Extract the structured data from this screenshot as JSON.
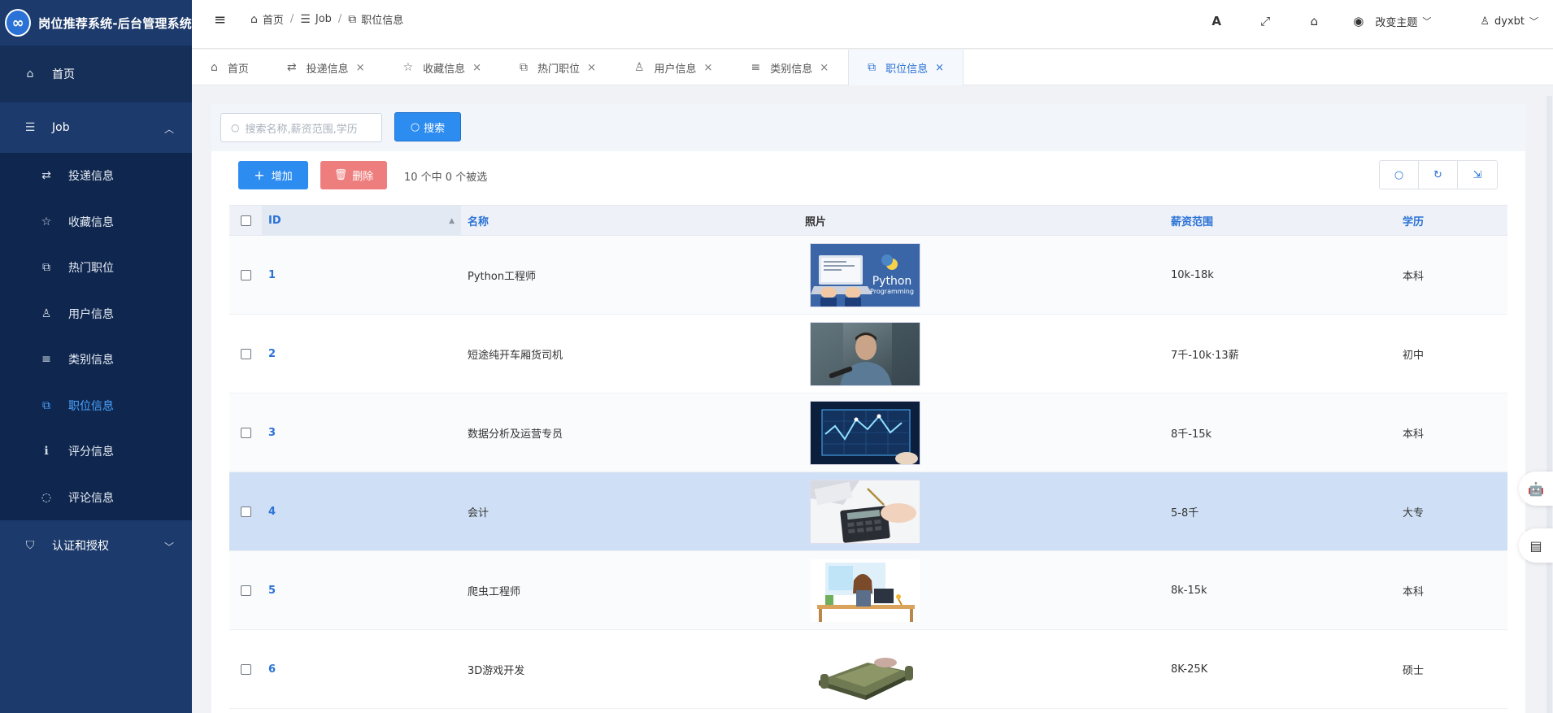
{
  "app_title": "岗位推荐系统-后台管理系统",
  "logo_glyph": "∞",
  "sidebar": {
    "home": "首页",
    "job_group": "Job",
    "items": [
      {
        "label": "投递信息",
        "icon": "⇄"
      },
      {
        "label": "收藏信息",
        "icon": "☆"
      },
      {
        "label": "热门职位",
        "icon": "⧉"
      },
      {
        "label": "用户信息",
        "icon": "♙"
      },
      {
        "label": "类别信息",
        "icon": "≡"
      },
      {
        "label": "职位信息",
        "icon": "⧉"
      },
      {
        "label": "评分信息",
        "icon": "ℹ"
      },
      {
        "label": "评论信息",
        "icon": "◌"
      }
    ],
    "auth_group": "认证和授权"
  },
  "header": {
    "breadcrumb": [
      "首页",
      "Job",
      "职位信息"
    ],
    "theme_label": "改变主题",
    "user_name": "dyxbt"
  },
  "tabs": [
    {
      "label": "首页",
      "icon": "⌂",
      "closable": false
    },
    {
      "label": "投递信息",
      "icon": "⇄",
      "closable": true
    },
    {
      "label": "收藏信息",
      "icon": "☆",
      "closable": true
    },
    {
      "label": "热门职位",
      "icon": "⧉",
      "closable": true
    },
    {
      "label": "用户信息",
      "icon": "♙",
      "closable": true
    },
    {
      "label": "类别信息",
      "icon": "≡",
      "closable": true
    },
    {
      "label": "职位信息",
      "icon": "⧉",
      "closable": true
    }
  ],
  "search": {
    "placeholder": "搜索名称,薪资范围,学历",
    "button": "搜索"
  },
  "toolbar": {
    "add": "增加",
    "delete": "删除",
    "selection_info": "10 个中 0 个被选"
  },
  "table": {
    "columns": {
      "id": "ID",
      "name": "名称",
      "photo": "照片",
      "salary": "薪资范围",
      "education": "学历"
    },
    "rows": [
      {
        "id": "1",
        "name": "Python工程师",
        "salary": "10k-18k",
        "education": "本科",
        "photo": "python",
        "python_title": "Python",
        "python_sub": "Programming"
      },
      {
        "id": "2",
        "name": "短途纯开车厢货司机",
        "salary": "7千-10k·13薪",
        "education": "初中",
        "photo": "driver"
      },
      {
        "id": "3",
        "name": "数据分析及运营专员",
        "salary": "8千-15k",
        "education": "本科",
        "photo": "data"
      },
      {
        "id": "4",
        "name": "会计",
        "salary": "5-8千",
        "education": "大专",
        "photo": "accounting",
        "selected": true
      },
      {
        "id": "5",
        "name": "爬虫工程师",
        "salary": "8k-15k",
        "education": "本科",
        "photo": "crawler"
      },
      {
        "id": "6",
        "name": "3D游戏开发",
        "salary": "8K-25K",
        "education": "硕士",
        "photo": "game"
      }
    ]
  },
  "colors": {
    "primary": "#2d8cf0",
    "sidebar": "#1c3a6b",
    "danger": "#ee7e7e",
    "selected_row": "#cfe0f6"
  }
}
